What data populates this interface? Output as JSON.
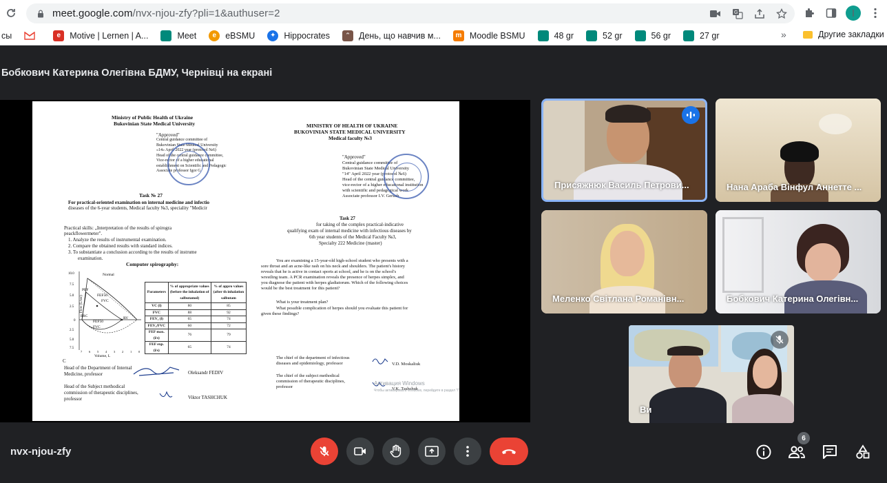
{
  "browser": {
    "url_host": "meet.google.com",
    "url_path": "/nvx-njou-zfy?pli=1&authuser=2",
    "profile_initial": "I",
    "bookmarks": [
      {
        "label": "сы",
        "icon": "bookmark-icon",
        "color": "#9aa0a6"
      },
      {
        "label": "",
        "icon": "gmail-icon",
        "color": "#ea4335"
      },
      {
        "label": "Motive | Lernen | A...",
        "icon": "motive-icon",
        "color": "#d93025"
      },
      {
        "label": "Meet",
        "icon": "meet-icon",
        "color": "#00897b"
      },
      {
        "label": "eBSMU",
        "icon": "ebsmu-icon",
        "color": "#f29900"
      },
      {
        "label": "Hippocrates",
        "icon": "hippocrates-icon",
        "color": "#1a73e8"
      },
      {
        "label": "День, що навчив м...",
        "icon": "cat-icon",
        "color": "#795548"
      },
      {
        "label": "Moodle BSMU",
        "icon": "moodle-icon",
        "color": "#f57c00"
      },
      {
        "label": "48 gr",
        "icon": "meet-icon",
        "color": "#00897b"
      },
      {
        "label": "52 gr",
        "icon": "meet-icon",
        "color": "#00897b"
      },
      {
        "label": "56 gr",
        "icon": "meet-icon",
        "color": "#00897b"
      },
      {
        "label": "27 gr",
        "icon": "meet-icon",
        "color": "#00897b"
      }
    ],
    "more_label": "»",
    "other_bookmarks": "Другие закладки"
  },
  "meet": {
    "presenting_title": "Бобкович Катерина Олегівна БДМУ, Чернівці на екрані",
    "meeting_code": "nvx-njou-zfy",
    "participants_count": "6",
    "participants": [
      {
        "name": "Присяжнюк Василь Петрови...",
        "speaking": true
      },
      {
        "name": "Нана Араба Вінфул Аннетте ...",
        "speaking": false
      },
      {
        "name": "Меленко Світлана Романівн...",
        "speaking": false
      },
      {
        "name": "Бобкович Катерина Олегівн...",
        "speaking": false
      },
      {
        "name": "Ви",
        "speaking": false,
        "muted": true
      }
    ],
    "colors": {
      "bg": "#202124",
      "button": "#3c4043",
      "end_call": "#ea4335",
      "speaking": "#1a73e8"
    }
  },
  "doc": {
    "left": {
      "ministry": "Ministry of Public Health of Ukraine",
      "university": "Bukovinian State Medical University",
      "approved": "\"Approved\"",
      "committee_1": "Central guidance committee of",
      "committee_2": "Bukovinian State Medical University",
      "committee_3": "«14» April 2022 year (protocol №6)",
      "committee_4": "Head of the central guidance committee,",
      "committee_5": "Vice-rector of a higher educational",
      "committee_6": "establishment on Scientific and Pedagogic",
      "committee_7": "Associate professor         Igor G",
      "task": "Task № 27",
      "task_line1": "For practical-oriented examination on internal medicine and infectio",
      "task_line2": "diseases of the 6-year students, Medical faculty №3, speciality \"Medicir",
      "skills": "Practical skills: „Interpretation of the results of spirogra",
      "skills2": "peackflowermeter\".",
      "step1": "1.  Analyze the results of instrumental examination.",
      "step2": "2.  Compare the obtained results with standard indices.",
      "step3": "3.  To substantiate a conclusion according to the results of instrume",
      "step3b": "examination.",
      "spiro_title": "Computer spirography:",
      "chart_labels": [
        "Normal",
        "PEF",
        "FEF50",
        "FVC",
        "FRC",
        "FEF50",
        "FVC",
        "RV",
        "Flow (L/sec)",
        "Volume, L"
      ],
      "chart_ticks": [
        "10.0",
        "7.5",
        "5.0",
        "2.5",
        "0",
        "2.5",
        "5.0",
        "7.5"
      ],
      "chart_xticks": [
        "7",
        "6",
        "5",
        "4",
        "3",
        "2",
        "1",
        "0"
      ],
      "table_headers": [
        "Parameters",
        "% of appropriate values (before the inhalation of salbutamol)",
        "% of appro values (after th inhalation salbutam"
      ],
      "table_rows": [
        [
          "VC (l)",
          "80",
          "85"
        ],
        [
          "FVC",
          "88",
          "92"
        ],
        [
          "FEV₁ (l)",
          "65",
          "74"
        ],
        [
          "FEV₁/FVC",
          "60",
          "72"
        ],
        [
          "FEF max. (l/s)",
          "76",
          "79"
        ],
        [
          "FEF exp. (l/s)",
          "65",
          "74"
        ]
      ],
      "sig1_a": "Head of the Department of Internal",
      "sig1_b": "Medicine, professor",
      "sig1_name": "Oleksandr FEDIV",
      "sig2_a": "Head of the Subject methodical",
      "sig2_b": "commission of therapeutic disciplines,",
      "sig2_c": "professor",
      "sig2_name": "Viktor TASHCHUK",
      "c_label": "C"
    },
    "right": {
      "ministry": "MINISTRY OF HEALTH OF UKRAINE",
      "university": "BUKOVINIAN STATE MEDICAL UNIVERSITY",
      "faculty": "Medical faculty №3",
      "approved": "\"Approved\"",
      "c1": "Central guidance committee of",
      "c2": "Bukovinian State Medical University",
      "c3": "\"14\" April 2022 year (protocol №6)",
      "c4": "Head of the central guidance committee,",
      "c5": "vice-rector of a higher educational institution",
      "c6": "with scientific and pedagogical work",
      "c7": "Associate professor         I.V. Gerush",
      "task": "Task 27",
      "t1": "for taking of the complex practical-indicative",
      "t2": "qualifying exam of internal medicine with infectious diseases by",
      "t3": "6th year students of the Medical Faculty №3,",
      "t4": "Specialty 222 Medicine (master)",
      "p1": "You are examining a 15-year-old high-school student who presents with a",
      "p2": "sore throat and an acne-like rash on his neck and shoulders. The patient's history",
      "p3": "reveals that he is active in contact sports at school, and he is on the school's",
      "p4": "wrestling team. A PCR examination reveals the presence of herpes simplex, and",
      "p5": "you diagnose the patient with herpes gladiatorum. Which of the following choices",
      "p6": "would be the best treatment for this patient?",
      "q1": "What is your treatment plan?",
      "q2": "What possible complication of herpes should you evaluate this patient for",
      "q3": "given these findings?",
      "s1a": "The chief of the department of infectious",
      "s1b": "diseases and epidemiology, professor",
      "s1name": "V.D. Moskaliuk",
      "s2a": "The chief of the subject methodical",
      "s2b": "commission of therapeutic disciplines,",
      "s2c": "professor",
      "s2name": "V.K. Tashchuk",
      "wm1": "Активация Windows",
      "wm2": "Чтобы активировать Windows, перейдите в раздел \"Параметры\"."
    }
  }
}
